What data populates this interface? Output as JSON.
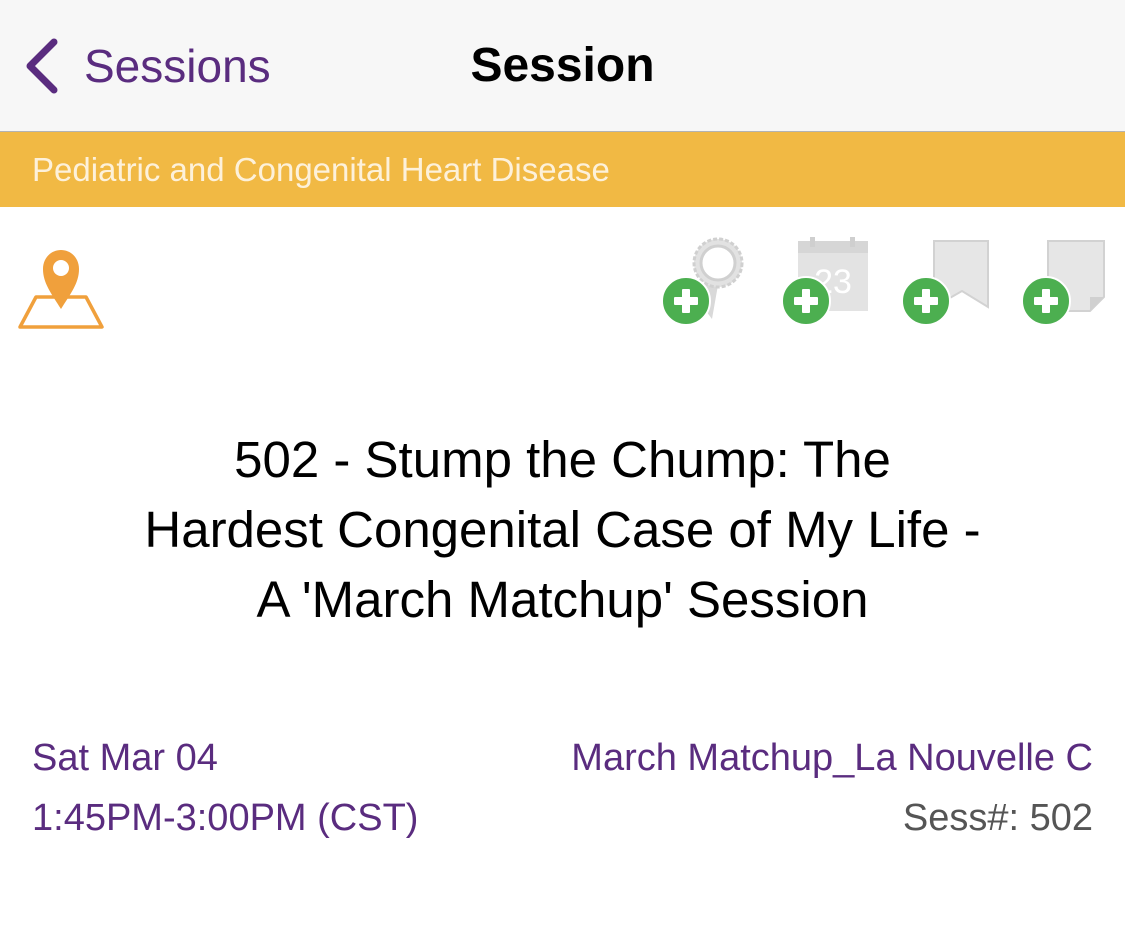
{
  "nav": {
    "back_label": "Sessions",
    "title": "Session"
  },
  "category": {
    "label": "Pediatric and Congenital Heart Disease"
  },
  "actions": {
    "calendar_day": "23"
  },
  "session": {
    "title_lines": [
      "502 - Stump the Chump: The",
      "Hardest Congenital Case of My Life -",
      "A 'March Matchup' Session"
    ],
    "date": "Sat Mar 04",
    "time": "1:45PM-3:00PM (CST)",
    "location": "March Matchup_La Nouvelle C",
    "number": "Sess#: 502"
  },
  "colors": {
    "accent_purple": "#5a2c7f",
    "category_bar": "#f1b944",
    "add_green": "#4caf50",
    "map_orange": "#f0a03c"
  },
  "icons": [
    "chevron-left-icon",
    "map-pin-icon",
    "award-ribbon-icon",
    "calendar-icon",
    "bookmark-icon",
    "note-icon",
    "plus-circle-icon"
  ]
}
